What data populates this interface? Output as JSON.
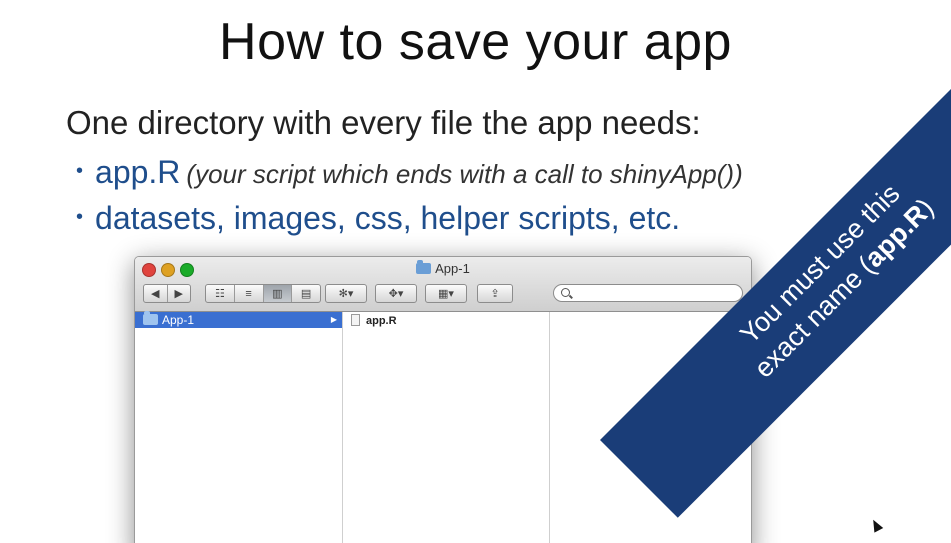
{
  "slide": {
    "title": "How to save your app",
    "lead": "One directory with every file the app needs:",
    "bullets": [
      {
        "main": "app.R",
        "note": "(your script which ends with a call to shinyApp())"
      },
      {
        "main": "datasets, images, css, helper scripts, etc.",
        "note": ""
      }
    ]
  },
  "finder": {
    "window_title": "App-1",
    "column1": [
      {
        "label": "App-1",
        "selected": true
      }
    ],
    "column2": [
      {
        "label": "app.R"
      }
    ],
    "toolbar": {
      "back": "◀",
      "forward": "▶",
      "view_icon": "☷",
      "view_list": "≡",
      "view_column": "▥",
      "view_flow": "▤",
      "action": "✻▾",
      "dropbox": "✥▾",
      "arrange": "▦▾",
      "share": "⇪"
    }
  },
  "banner": {
    "line1": "You must use this",
    "line2_prefix": "exact name (",
    "line2_bold": "app.R",
    "line2_suffix": ")"
  },
  "colors": {
    "bullet": "#1f4e8c",
    "banner": "#1a3d78",
    "selection": "#3a6fd1"
  },
  "icons": [
    "folder-icon",
    "file-icon",
    "search-icon",
    "disclosure-arrow-icon",
    "mouse-cursor-icon"
  ]
}
